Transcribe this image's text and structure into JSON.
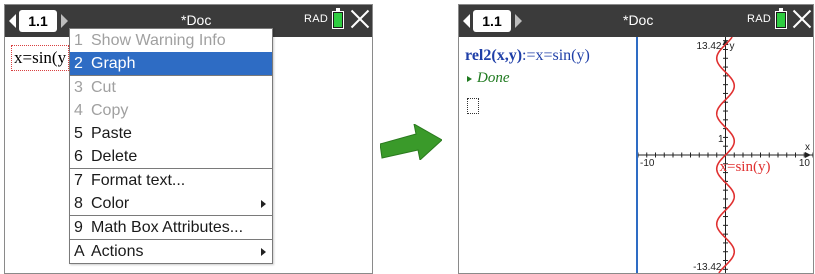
{
  "left_screen": {
    "tab_label": "1.1",
    "doc_title": "*Doc",
    "angle_mode": "RAD",
    "expression": "x=sin(y",
    "context_menu": [
      {
        "key": "1",
        "label": "Show Warning Info",
        "disabled": true
      },
      {
        "key": "2",
        "label": "Graph",
        "selected": true
      },
      {
        "separator": true
      },
      {
        "key": "3",
        "label": "Cut",
        "disabled": true
      },
      {
        "key": "4",
        "label": "Copy",
        "disabled": true
      },
      {
        "key": "5",
        "label": "Paste"
      },
      {
        "key": "6",
        "label": "Delete"
      },
      {
        "separator": true
      },
      {
        "key": "7",
        "label": "Format text..."
      },
      {
        "key": "8",
        "label": "Color",
        "submenu": true
      },
      {
        "separator": true
      },
      {
        "key": "9",
        "label": "Math Box Attributes..."
      },
      {
        "separator": true
      },
      {
        "key": "A",
        "label": "Actions",
        "submenu": true
      }
    ]
  },
  "right_screen": {
    "tab_label": "1.1",
    "doc_title": "*Doc",
    "angle_mode": "RAD",
    "definition_name": "rel2(x,y)",
    "definition_body": ":=x=sin(y)",
    "result": "Done",
    "graph": {
      "y_max_label": "13.42",
      "y_min_label": "-13.42",
      "x_min_label": "-10",
      "x_max_label": "10",
      "tick_one_label": "1",
      "x_axis_name": "x",
      "y_axis_name": "y",
      "curve_label": "x=sin(y)",
      "curve_color": "#e03030",
      "x_range": [
        -10,
        10
      ],
      "y_range": [
        -13.42,
        13.42
      ]
    }
  },
  "colors": {
    "tabbar": "#3b3b3b",
    "menu_highlight": "#2e6cc4",
    "arrow": "#3a9a2a",
    "definition": "#1f3fa8",
    "result": "#1f7a1f"
  }
}
